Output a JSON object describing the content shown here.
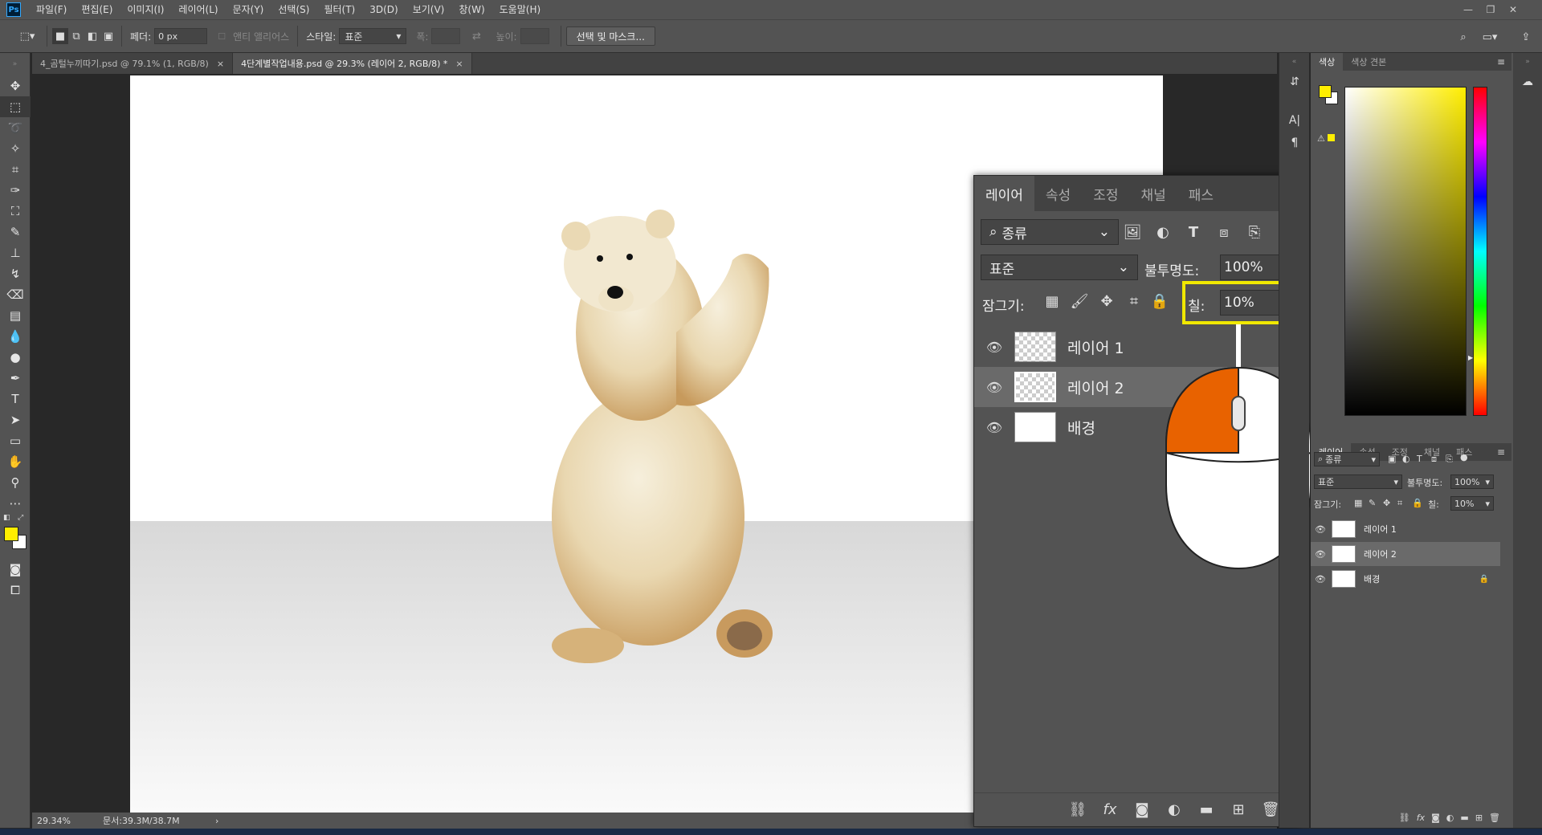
{
  "app": {
    "logo": "Ps"
  },
  "menu": [
    "파일(F)",
    "편집(E)",
    "이미지(I)",
    "레이어(L)",
    "문자(Y)",
    "선택(S)",
    "필터(T)",
    "3D(D)",
    "보기(V)",
    "창(W)",
    "도움말(H)"
  ],
  "options": {
    "feather_label": "페더:",
    "feather_value": "0 px",
    "antialias_label": "앤티 앨리어스",
    "style_label": "스타일:",
    "style_value": "표준",
    "width_label": "폭:",
    "height_label": "높이:",
    "select_mask_button": "선택 및 마스크..."
  },
  "tabs": [
    {
      "label": "4_곰털누끼따기.psd @ 79.1% (1, RGB/8)",
      "close": "×"
    },
    {
      "label": "4단계별작업내용.psd @ 29.3% (레이어 2, RGB/8) *",
      "close": "×"
    }
  ],
  "status": {
    "zoom": "29.34%",
    "doc": "문서:39.3M/38.7M",
    "arrow": "›"
  },
  "layers_panel": {
    "tabs": [
      "레이어",
      "속성",
      "조정",
      "채널",
      "패스"
    ],
    "filter_value": "종류",
    "blend_mode": "표준",
    "opacity_label": "불투명도:",
    "opacity_value": "100%",
    "lock_label": "잠그기:",
    "fill_label": "칠:",
    "fill_value": "10%",
    "layers": [
      {
        "name": "레이어 1",
        "selected": false
      },
      {
        "name": "레이어 2",
        "selected": true
      },
      {
        "name": "배경",
        "selected": false
      }
    ]
  },
  "color_panel": {
    "tabs": [
      "색상",
      "색상 견본"
    ],
    "foreground_color": "#ffee00",
    "background_color": "#ffffff"
  },
  "small_layers_panel": {
    "tabs": [
      "레이어",
      "속성",
      "조정",
      "채널",
      "패스"
    ],
    "filter_value": "종류",
    "blend_mode": "표준",
    "opacity_label": "불투명도:",
    "opacity_value": "100%",
    "lock_label": "잠그기:",
    "fill_label": "칠:",
    "fill_value": "10%",
    "layers": [
      "레이어 1",
      "레이어 2",
      "배경"
    ]
  },
  "colors": {
    "highlight": "#f0e800",
    "mouse_left": "#e86200"
  }
}
